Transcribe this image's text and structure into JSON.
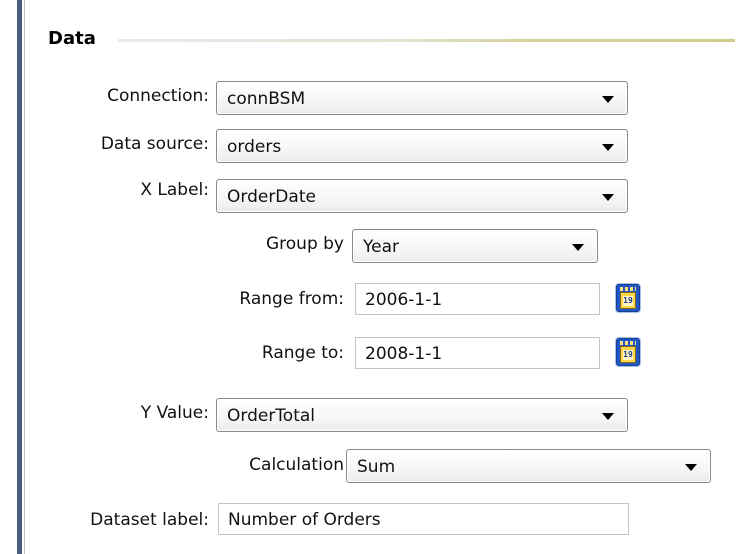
{
  "section": {
    "title": "Data"
  },
  "fields": {
    "connection": {
      "label": "Connection:",
      "value": "connBSM"
    },
    "data_source": {
      "label": "Data source:",
      "value": "orders"
    },
    "x_label": {
      "label": "X Label:",
      "value": "OrderDate"
    },
    "group_by": {
      "label": "Group by",
      "value": "Year"
    },
    "range_from": {
      "label": "Range from:",
      "value": "2006-1-1"
    },
    "range_to": {
      "label": "Range to:",
      "value": "2008-1-1"
    },
    "y_value": {
      "label": "Y Value:",
      "value": "OrderTotal"
    },
    "calculation": {
      "label": "Calculation",
      "value": "Sum"
    },
    "dataset_label": {
      "label": "Dataset label:",
      "value": "Number of Orders"
    }
  },
  "icons": {
    "date_picker": "calendar-icon"
  },
  "colors": {
    "section_rule": "#d2cc8c",
    "left_bar": "#4a5f7f",
    "calendar": "#1e58c8"
  }
}
